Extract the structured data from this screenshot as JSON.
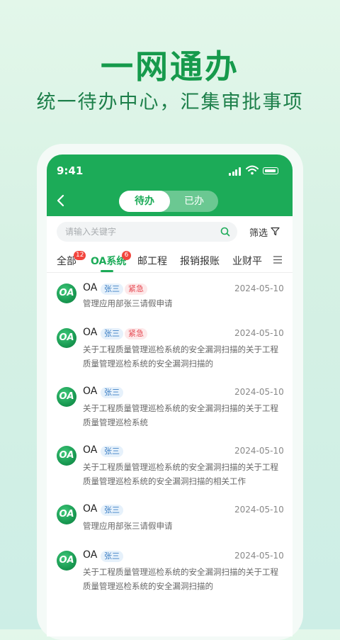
{
  "hero": {
    "title": "一网通办",
    "subtitle": "统一待办中心，汇集审批事项"
  },
  "status_bar": {
    "time": "9:41"
  },
  "header": {
    "segments": [
      "待办",
      "已办"
    ],
    "active_segment": "待办"
  },
  "search": {
    "placeholder": "请输入关键字",
    "value": ""
  },
  "filter": {
    "label": "筛选"
  },
  "tabs": [
    {
      "label": "全部",
      "badge": "12"
    },
    {
      "label": "OA系统",
      "badge": "6",
      "active": true
    },
    {
      "label": "邮工程"
    },
    {
      "label": "报销报账"
    },
    {
      "label": "业财平"
    }
  ],
  "items": [
    {
      "avatar": "OA",
      "name": "OA",
      "user_tag": "张三",
      "urgent_tag": "紧急",
      "date": "2024-05-10",
      "desc": "管理应用部张三请假申请"
    },
    {
      "avatar": "OA",
      "name": "OA",
      "user_tag": "张三",
      "urgent_tag": "紧急",
      "date": "2024-05-10",
      "desc": "关于工程质量管理巡检系统的安全漏洞扫描的关于工程质量管理巡检系统的安全漏洞扫描的"
    },
    {
      "avatar": "OA",
      "name": "OA",
      "user_tag": "张三",
      "urgent_tag": "",
      "date": "2024-05-10",
      "desc": "关于工程质量管理巡检系统的安全漏洞扫描的关于工程质量管理巡检系统"
    },
    {
      "avatar": "OA",
      "name": "OA",
      "user_tag": "张三",
      "urgent_tag": "",
      "date": "2024-05-10",
      "desc": "关于工程质量管理巡检系统的安全漏洞扫描的关于工程质量管理巡检系统的安全漏洞扫描的相关工作"
    },
    {
      "avatar": "OA",
      "name": "OA",
      "user_tag": "张三",
      "urgent_tag": "",
      "date": "2024-05-10",
      "desc": "管理应用部张三请假申请"
    },
    {
      "avatar": "OA",
      "name": "OA",
      "user_tag": "张三",
      "urgent_tag": "",
      "date": "2024-05-10",
      "desc": "关于工程质量管理巡检系统的安全漏洞扫描的关于工程质量管理巡检系统的安全漏洞扫描的"
    }
  ],
  "colors": {
    "brand": "#1cab58",
    "urgent": "#e64c55",
    "user_tag": "#3d7fc4",
    "badge": "#f2453d"
  }
}
